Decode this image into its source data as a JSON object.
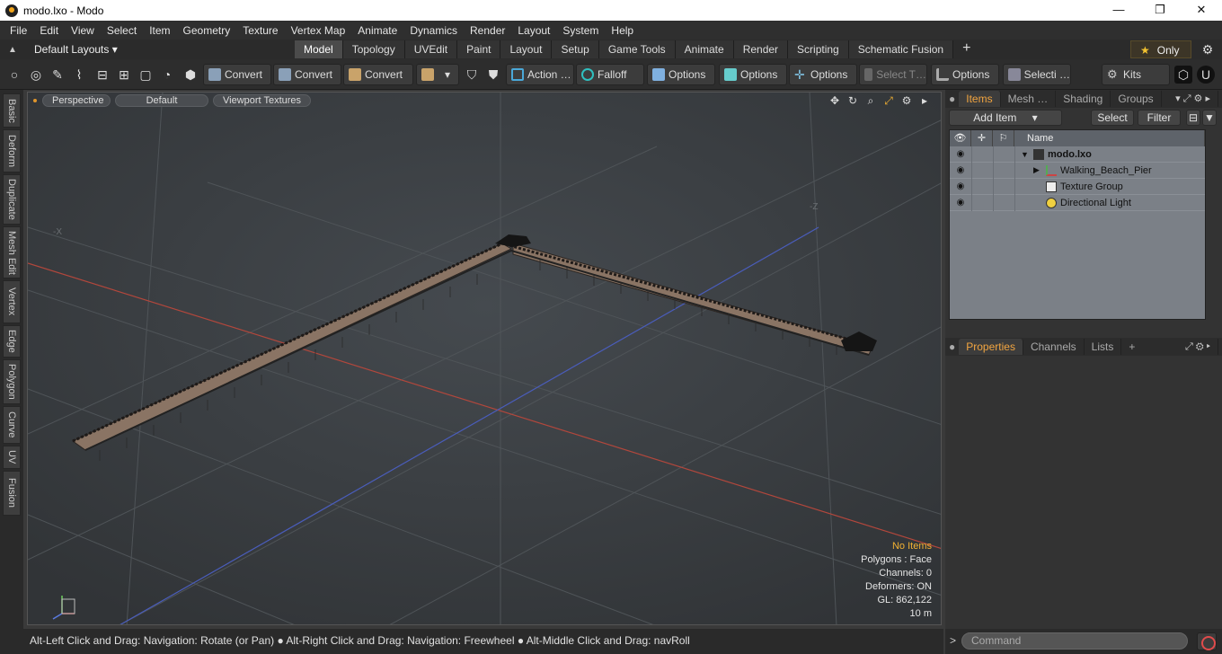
{
  "window": {
    "title": "modo.lxo - Modo",
    "minimize": "—",
    "maximize": "❐",
    "close": "✕"
  },
  "menu": [
    "File",
    "Edit",
    "View",
    "Select",
    "Item",
    "Geometry",
    "Texture",
    "Vertex Map",
    "Animate",
    "Dynamics",
    "Render",
    "Layout",
    "System",
    "Help"
  ],
  "layouts": {
    "dropdown": "Default Layouts ▾",
    "tabs": [
      "Model",
      "Topology",
      "UVEdit",
      "Paint",
      "Layout",
      "Setup",
      "Game Tools",
      "Animate",
      "Render",
      "Scripting",
      "Schematic Fusion"
    ],
    "active_tab": "Model",
    "add": "+",
    "only_label": "Only"
  },
  "toolbar": {
    "convert1": "Convert",
    "convert2": "Convert",
    "convert3": "Convert",
    "action": "Action …",
    "falloff": "Falloff",
    "options1": "Options",
    "options2": "Options",
    "options3": "Options",
    "options4": "Options",
    "select_t": "Select T…",
    "selecti": "Selecti …",
    "kits": "Kits"
  },
  "left_tabs": [
    "Basic",
    "Deform",
    "Duplicate",
    "Mesh Edit",
    "Vertex",
    "Edge",
    "Polygon",
    "Curve",
    "UV",
    "Fusion"
  ],
  "viewport": {
    "view": "Perspective",
    "shading": "Default",
    "textures": "Viewport Textures",
    "stats": {
      "items": "No Items",
      "polygons": "Polygons : Face",
      "channels": "Channels: 0",
      "deformers": "Deformers: ON",
      "gl": "GL: 862,122",
      "scale": "10 m"
    },
    "axis_labels": {
      "x_neg": "-X",
      "z_neg": "-Z"
    }
  },
  "status_text": "Alt-Left Click and Drag: Navigation: Rotate (or Pan) ● Alt-Right Click and Drag: Navigation: Freewheel ● Alt-Middle Click and Drag: navRoll",
  "items_panel": {
    "tabs": [
      "Items",
      "Mesh …",
      "Shading",
      "Groups"
    ],
    "active": "Items",
    "add_item": "Add Item",
    "select": "Select",
    "filter": "Filter",
    "column_name": "Name",
    "tree": [
      {
        "label": "modo.lxo",
        "bold": true,
        "icon": "scene-icon"
      },
      {
        "label": "Walking_Beach_Pier",
        "icon": "mesh-icon"
      },
      {
        "label": "Texture Group",
        "icon": "texture-icon"
      },
      {
        "label": "Directional Light",
        "icon": "light-icon"
      }
    ]
  },
  "properties_panel": {
    "tabs": [
      "Properties",
      "Channels",
      "Lists"
    ],
    "active": "Properties",
    "add": "+"
  },
  "command": {
    "placeholder": "Command",
    "prompt": ">"
  },
  "colors": {
    "accent": "#f2a540",
    "x_axis": "#c0443a",
    "z_axis": "#4a5fc0",
    "bg": "#3b3f43"
  }
}
